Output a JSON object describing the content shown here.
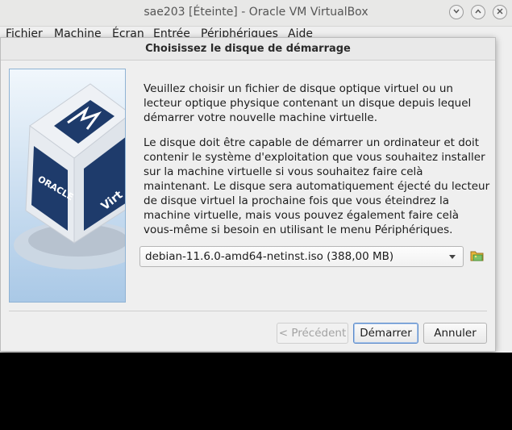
{
  "window": {
    "title": "sae203 [Éteinte] - Oracle VM VirtualBox",
    "minimize_icon": "chevron-down-icon",
    "maximize_icon": "chevron-up-icon",
    "close_icon": "close-icon"
  },
  "menubar": {
    "items": [
      "Fichier",
      "Machine",
      "Écran",
      "Entrée",
      "Périphériques",
      "Aide"
    ]
  },
  "dialog": {
    "title": "Choisissez le disque de démarrage",
    "paragraph1": "Veuillez choisir un fichier de disque optique virtuel ou un lecteur optique physique contenant un disque depuis lequel démarrer votre nouvelle machine virtuelle.",
    "paragraph2": "Le disque doit être capable de démarrer un ordinateur et doit contenir le système d'exploitation que vous souhaitez installer sur la machine virtuelle si vous souhaitez faire celà maintenant. Le disque sera automatiquement éjecté du lecteur de disque virtuel la prochaine fois que vous éteindrez la machine virtuelle, mais vous pouvez également faire celà vous-même si besoin en utilisant le menu Périphériques.",
    "side_image_text": [
      "ORACLE",
      "Virt"
    ],
    "disk_select": {
      "selected": "debian-11.6.0-amd64-netinst.iso (388,00 MB)"
    },
    "buttons": {
      "previous": "< Précédent",
      "start": "Démarrer",
      "cancel": "Annuler"
    },
    "accent_color": "#5b8ac9"
  }
}
